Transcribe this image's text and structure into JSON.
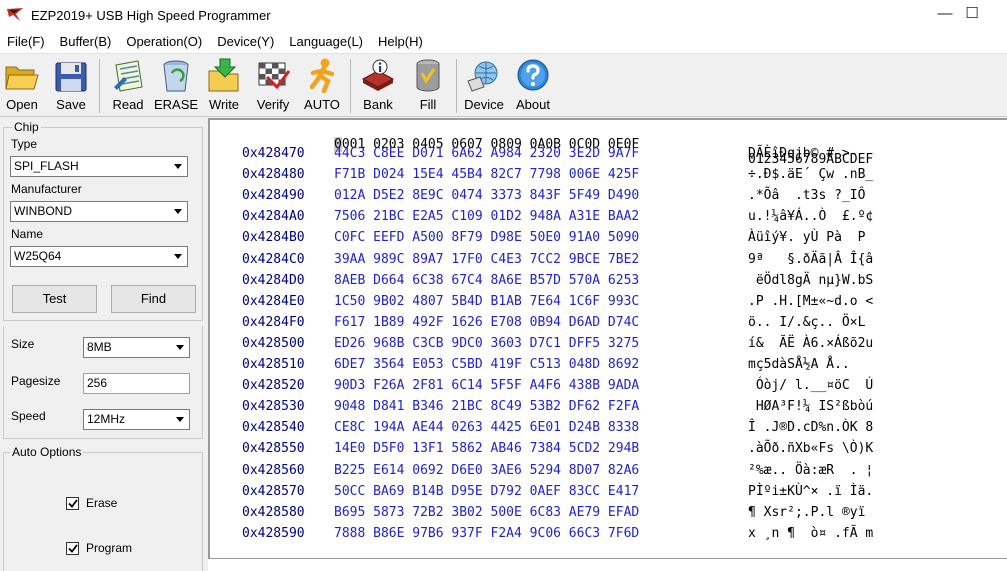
{
  "window": {
    "title": "EZP2019+ USB High Speed Programmer",
    "minimize_glyph": "—",
    "maximize_glyph": "☐"
  },
  "menu": [
    "File(F)",
    "Buffer(B)",
    "Operation(O)",
    "Device(Y)",
    "Language(L)",
    "Help(H)"
  ],
  "toolbar": {
    "open": "Open",
    "save": "Save",
    "read": "Read",
    "erase": "ERASE",
    "write": "Write",
    "verify": "Verify",
    "auto": "AUTO",
    "bank": "Bank",
    "fill": "Fill",
    "device": "Device",
    "about": "About"
  },
  "chip": {
    "group_title": "Chip",
    "type_label": "Type",
    "type_value": "SPI_FLASH",
    "manufacturer_label": "Manufacturer",
    "manufacturer_value": "WINBOND",
    "name_label": "Name",
    "name_value": "W25Q64",
    "test_button": "Test",
    "find_button": "Find"
  },
  "params": {
    "size_label": "Size",
    "size_value": "8MB",
    "pagesize_label": "Pagesize",
    "pagesize_value": "256",
    "speed_label": "Speed",
    "speed_value": "12MHz"
  },
  "auto_options": {
    "group_title": "Auto Options",
    "erase_label": "Erase",
    "erase_checked": true,
    "program_label": "Program",
    "program_checked": true
  },
  "hex": {
    "header_cursor": "0",
    "header_rest": "001 0203 0405 0607 0809 0A0B 0C0D 0E0F",
    "header_ascii": "0123456789ABCDEF",
    "rows": [
      {
        "addr": "0x428470",
        "hex": "44C3 C8EE D071 6A62 A984 2320 3E2D 9A7F",
        "ascii": "DÃÈîÐqjb© # >- "
      },
      {
        "addr": "0x428480",
        "hex": "F71B D024 15E4 45B4 82C7 7798 006E 425F",
        "ascii": "÷.Ð$.äE´ Çw .nB_"
      },
      {
        "addr": "0x428490",
        "hex": "012A D5E2 8E9C 0474 3373 843F 5F49 D490",
        "ascii": ".*Õâ  .t3s ?_IÔ"
      },
      {
        "addr": "0x4284A0",
        "hex": "7506 21BC E2A5 C109 01D2 948A A31E BAA2",
        "ascii": "u.!¼â¥Á..Ò  £.º¢"
      },
      {
        "addr": "0x4284B0",
        "hex": "C0FC EEFD A500 8F79 D98E 50E0 91A0 5090",
        "ascii": "Àüîý¥. yÙ Pà  P"
      },
      {
        "addr": "0x4284C0",
        "hex": "39AA 989C 89A7 17F0 C4E3 7CC2 9BCE 7BE2",
        "ascii": "9ª   §.ðÄã|Â Î{â"
      },
      {
        "addr": "0x4284D0",
        "hex": "8AEB D664 6C38 67C4 8A6E B57D 570A 6253",
        "ascii": " ëÖdl8gÄ nµ}W.bS"
      },
      {
        "addr": "0x4284E0",
        "hex": "1C50 9B02 4807 5B4D B1AB 7E64 1C6F 993C",
        "ascii": ".P .H.[M±«~d.o <"
      },
      {
        "addr": "0x4284F0",
        "hex": "F617 1B89 492F 1626 E708 0B94 D6AD D74C",
        "ascii": "ö.. I/.&ç.. Ö­×L"
      },
      {
        "addr": "0x428500",
        "hex": "ED26 968B C3CB 9DC0 3603 D7C1 DFF5 3275",
        "ascii": "í&  ÃË À6.×Áßõ2u"
      },
      {
        "addr": "0x428510",
        "hex": "6DE7 3564 E053 C5BD 419F C513 048D 8692",
        "ascii": "mç5dàSÅ½A Å..  "
      },
      {
        "addr": "0x428520",
        "hex": "90D3 F26A 2F81 6C14 5F5F A4F6 438B 9ADA",
        "ascii": " Óòj/ l.__¤öC  Ú"
      },
      {
        "addr": "0x428530",
        "hex": "9048 D841 B346 21BC 8C49 53B2 DF62 F2FA",
        "ascii": " HØA³F!¼ IS²ßbòú"
      },
      {
        "addr": "0x428540",
        "hex": "CE8C 194A AE44 0263 4425 6E01 D24B 8338",
        "ascii": "Î .J®D.cD%n.ÒK 8"
      },
      {
        "addr": "0x428550",
        "hex": "14E0 D5F0 13F1 5862 AB46 7384 5CD2 294B",
        "ascii": ".àÕð.ñXb«Fs \\Ò)K"
      },
      {
        "addr": "0x428560",
        "hex": "B225 E614 0692 D6E0 3AE6 5294 8D07 82A6",
        "ascii": "²%æ.. Öà:æR  . ¦"
      },
      {
        "addr": "0x428570",
        "hex": "50CC BA69 B14B D95E D792 0AEF 83CC E417",
        "ascii": "PÌºi±KÙ^× .ï Ìä."
      },
      {
        "addr": "0x428580",
        "hex": "B695 5873 72B2 3B02 500E 6C83 AE79 EFAD",
        "ascii": "¶ Xsr²;.P.l ®yï­"
      },
      {
        "addr": "0x428590",
        "hex": "7888 B86E 97B6 937F F2A4 9C06 66C3 7F6D",
        "ascii": "x ¸n ¶  ò¤ .fÃ m"
      }
    ]
  },
  "log": {
    "text": ""
  }
}
